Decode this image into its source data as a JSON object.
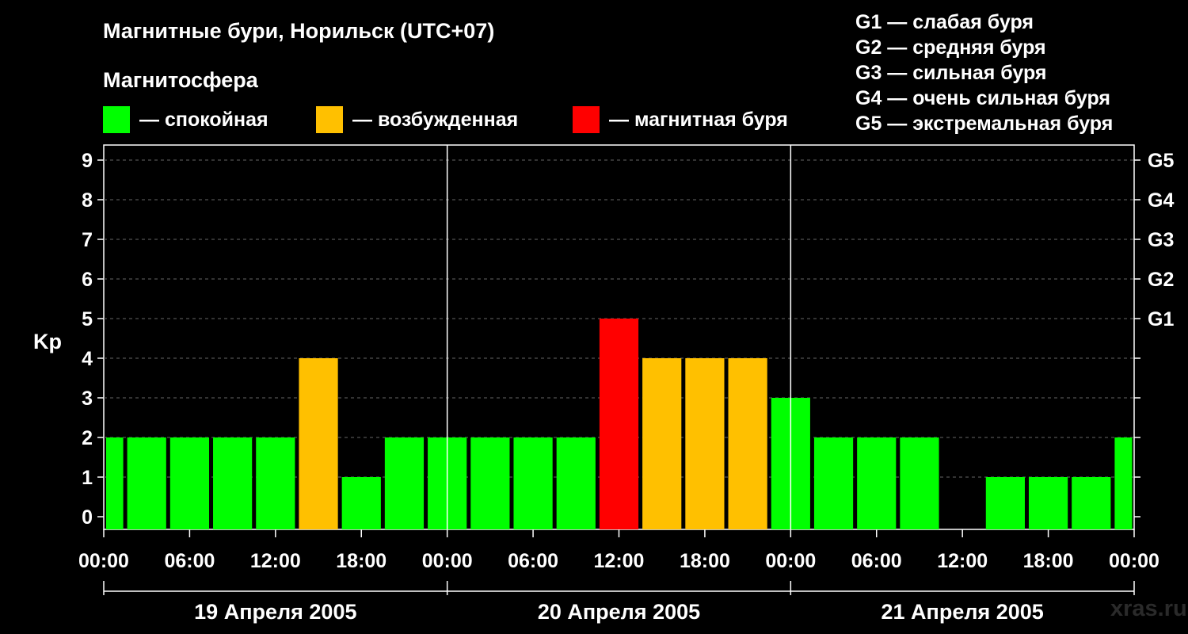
{
  "header": {
    "title": "Магнитные бури, Норильск (UTC+07)",
    "magnetosphere_label": "Магнитосфера"
  },
  "legend": [
    {
      "label": "— спокойная",
      "color": "#00ff00"
    },
    {
      "label": "— возбужденная",
      "color": "#ffc000"
    },
    {
      "label": "— магнитная буря",
      "color": "#ff0000"
    }
  ],
  "g_legend": [
    "G1 — слабая буря",
    "G2 — средняя буря",
    "G3 — сильная буря",
    "G4 — очень сильная буря",
    "G5 — экстремальная буря"
  ],
  "watermark": "xras.ru",
  "chart_data": {
    "type": "bar",
    "ylabel": "Kp",
    "ylim": [
      0,
      9
    ],
    "yticks": [
      "0",
      "1",
      "2",
      "3",
      "4",
      "5",
      "6",
      "7",
      "8",
      "9"
    ],
    "right_ticks": [
      {
        "value": 5,
        "label": "G1"
      },
      {
        "value": 6,
        "label": "G2"
      },
      {
        "value": 7,
        "label": "G3"
      },
      {
        "value": 8,
        "label": "G4"
      },
      {
        "value": 9,
        "label": "G5"
      }
    ],
    "xtick_labels": [
      "00:00",
      "06:00",
      "12:00",
      "18:00",
      "00:00",
      "06:00",
      "12:00",
      "18:00",
      "00:00",
      "06:00",
      "12:00",
      "18:00",
      "00:00"
    ],
    "day_labels": [
      "19 Апреля 2005",
      "20 Апреля 2005",
      "21 Апреля 2005"
    ],
    "grid": true,
    "interval_hours": 3,
    "first_bar_partial": true,
    "values": [
      2,
      2,
      2,
      2,
      2,
      4,
      1,
      2,
      2,
      2,
      2,
      2,
      5,
      4,
      4,
      4,
      3,
      2,
      2,
      2,
      0,
      1,
      1,
      1,
      2
    ],
    "colors": {
      "quiet": "#00ff00",
      "active": "#ffc000",
      "storm": "#ff0000"
    }
  }
}
